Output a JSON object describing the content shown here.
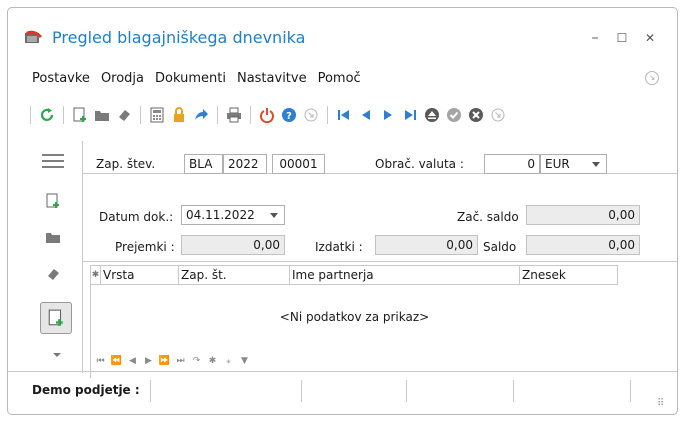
{
  "window": {
    "title": "Pregled blagajniškega dnevnika",
    "minimize_glyph": "–",
    "maximize_glyph": "☐",
    "close_glyph": "✕"
  },
  "menu": {
    "items": [
      "Postavke",
      "Orodja",
      "Dokumenti",
      "Nastavitve",
      "Pomoč"
    ],
    "end_icon": "collapse-arrow-icon"
  },
  "toolbar": {
    "icons": [
      "refresh-icon",
      "new-document-icon",
      "folder-icon",
      "eraser-icon",
      "calculator-icon",
      "lock-icon",
      "forward-arrow-icon",
      "print-icon",
      "power-icon",
      "help-icon",
      "circle-arrow-icon",
      "first-record-icon",
      "previous-record-icon",
      "next-record-icon",
      "last-record-icon",
      "eject-icon",
      "confirm-icon",
      "cancel-icon",
      "collapse-icon"
    ]
  },
  "header": {
    "zap_stev_label": "Zap. štev.",
    "code": "BLA",
    "year": "2022",
    "number": "00001",
    "valuta_label": "Obrač. valuta :",
    "valuta_amount": "0",
    "currency": "EUR"
  },
  "form": {
    "datum_label": "Datum dok.:",
    "datum_value": "04.11.2022",
    "zac_saldo_label": "Zač. saldo",
    "zac_saldo_value": "0,00",
    "prejemki_label": "Prejemki :",
    "prejemki_value": "0,00",
    "izdatki_label": "Izdatki :",
    "izdatki_value": "0,00",
    "saldo_label": "Saldo",
    "saldo_value": "0,00"
  },
  "grid": {
    "columns": [
      "Vrsta",
      "Zap. št.",
      "Ime partnerja",
      "Znesek"
    ],
    "empty_message": "<Ni podatkov za prikaz>",
    "nav_glyphs": [
      "⏮",
      "⏪",
      "◀",
      "▶",
      "⏩",
      "⏭",
      "↷",
      "✱",
      "⁎",
      "▼"
    ]
  },
  "status": {
    "company_label": "Demo podjetje :"
  },
  "colors": {
    "title": "#1f80c8",
    "refresh": "#2aa84a",
    "accent_blue": "#2f7fd0",
    "power": "#e04a2c",
    "lock": "#e8a41d"
  }
}
